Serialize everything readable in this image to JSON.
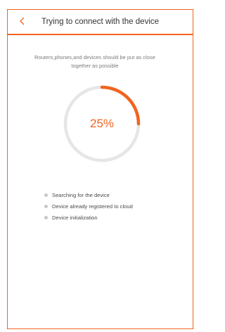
{
  "header": {
    "title": "Trying to connect with the device",
    "back_icon": "chevron-left-icon"
  },
  "hint": "Routers,phones,and devices should be put as close together as possible",
  "progress": {
    "label": "25%",
    "value": 0.25
  },
  "steps": [
    {
      "label": "Searching for the device"
    },
    {
      "label": "Device already registered to cloud"
    },
    {
      "label": "Device initialization"
    }
  ],
  "colors": {
    "accent": "#f0641e",
    "track": "#e6e6e6",
    "bullet": "#c8c8c8"
  }
}
